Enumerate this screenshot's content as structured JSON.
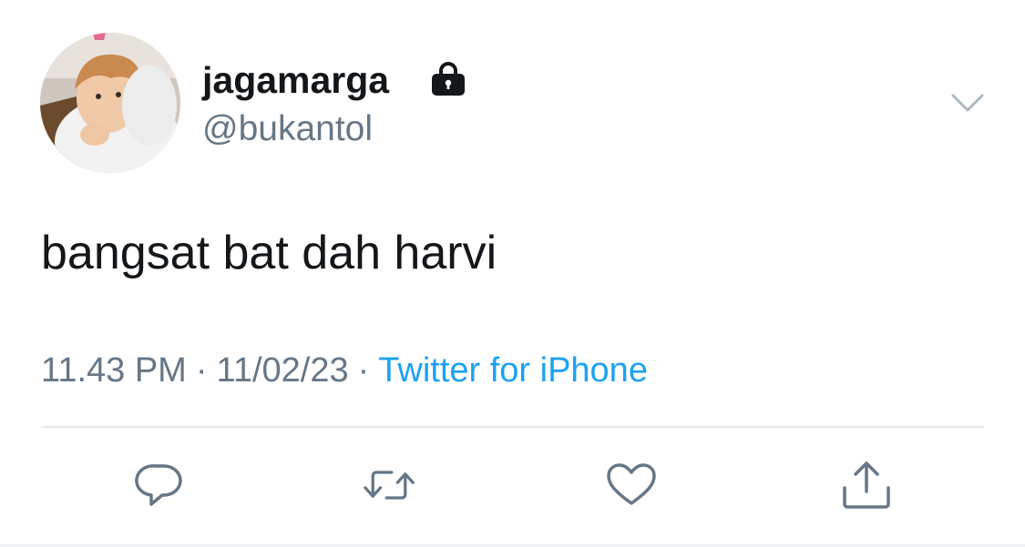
{
  "user": {
    "display_name": "jagamarga",
    "handle": "@bukantol",
    "protected_icon": "lock-icon",
    "avatar": "profile-photo"
  },
  "tweet": {
    "text": "bangsat bat dah harvi",
    "time": "11.43 PM",
    "date": "11/02/23",
    "separator": "·",
    "source": "Twitter for iPhone"
  },
  "actions": [
    {
      "name": "reply",
      "icon": "reply-icon"
    },
    {
      "name": "retweet",
      "icon": "retweet-icon"
    },
    {
      "name": "like",
      "icon": "heart-icon"
    },
    {
      "name": "share",
      "icon": "share-icon"
    }
  ],
  "menu_icon": "chevron-down-icon",
  "colors": {
    "text": "#14171a",
    "secondary": "#657786",
    "link": "#1da1f2",
    "icon": "#657786",
    "divider": "#e1e8ed"
  }
}
